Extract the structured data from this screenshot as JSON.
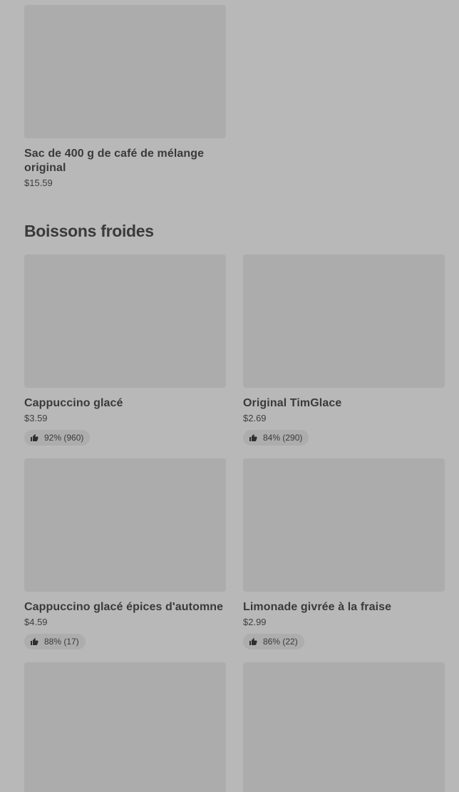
{
  "top_product": {
    "name": "Sac de 400 g de café de mélange original",
    "price": "$15.59"
  },
  "section": {
    "title": "Boissons froides"
  },
  "products": [
    {
      "name": "Cappuccino glacé",
      "price": "$3.59",
      "rating": "92% (960)"
    },
    {
      "name": "Original TimGlace",
      "price": "$2.69",
      "rating": "84% (290)"
    },
    {
      "name": "Cappuccino glacé épices d'automne",
      "price": "$4.59",
      "rating": "88% (17)"
    },
    {
      "name": "Limonade givrée à la fraise",
      "price": "$2.99",
      "rating": "86% (22)"
    }
  ],
  "icons": {
    "rating": "thumbs-up-icon"
  },
  "colors": {
    "background": "#b8b8b8",
    "image_placeholder": "#acacac",
    "rating_pill": "#adadad",
    "text": "#3a3a3a"
  }
}
